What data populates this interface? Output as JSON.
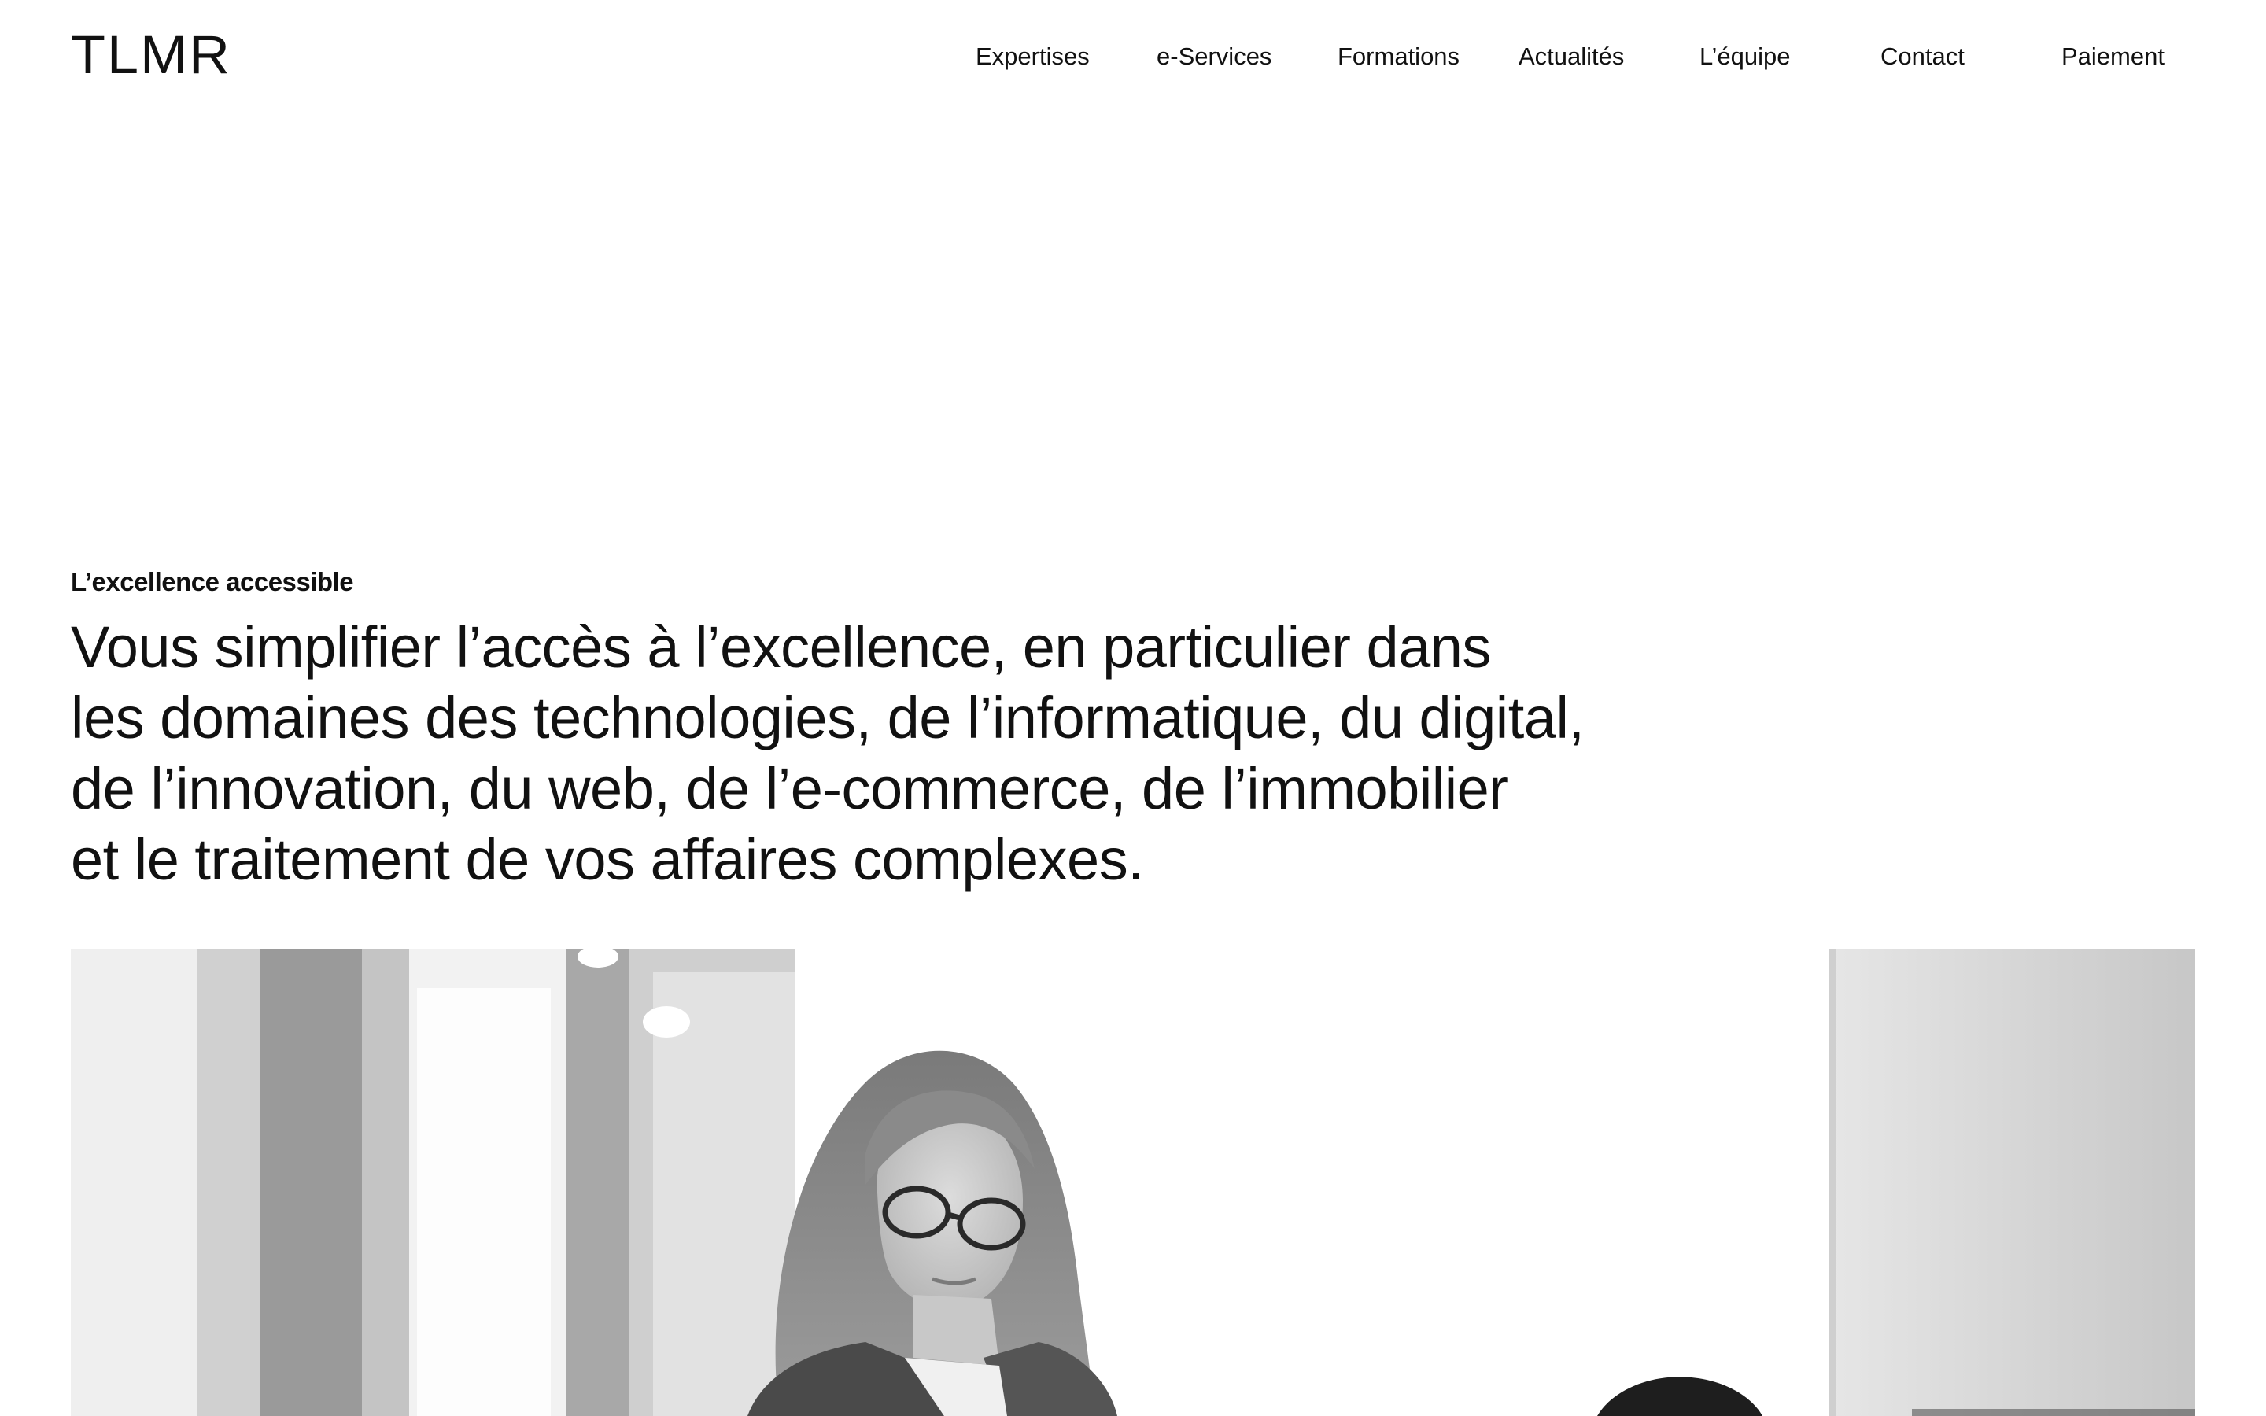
{
  "header": {
    "logo": "TLMR",
    "nav": [
      {
        "label": "Expertises"
      },
      {
        "label": "e-Services"
      },
      {
        "label": "Formations"
      },
      {
        "label": "Actualités"
      },
      {
        "label": "L’équipe"
      },
      {
        "label": "Contact"
      },
      {
        "label": "Paiement"
      }
    ]
  },
  "hero": {
    "eyebrow": "L’excellence accessible",
    "headline_lines": [
      "Vous simplifier l’accès à l’excellence, en particulier dans",
      "les domaines des technologies, de l’informatique, du digital,",
      "de l’innovation, du web, de l’e-commerce, de l’immobilier",
      "et le traitement de vos affaires complexes."
    ]
  }
}
